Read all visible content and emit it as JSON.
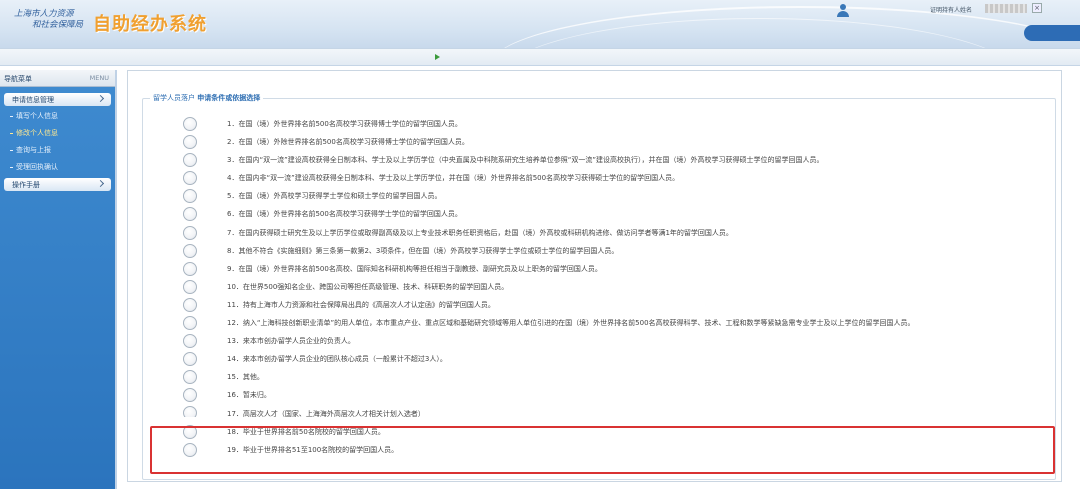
{
  "header": {
    "org_line1": "上海市人力资源",
    "org_line2": "和社会保障局",
    "app_title": "自助经办系统",
    "user_name": "证明持有人姓名",
    "close_label": "×"
  },
  "sidebar": {
    "title": "导航菜单",
    "title_en": "MENU",
    "groups": [
      {
        "label": "申请信息管理",
        "items": [
          {
            "label": "填写个人信息"
          },
          {
            "label": "修改个人信息"
          },
          {
            "label": "查询与上报"
          },
          {
            "label": "受理回执确认"
          }
        ]
      },
      {
        "label": "操作手册"
      }
    ]
  },
  "main": {
    "breadcrumb_section": "留学人员落户",
    "breadcrumb_page": "申请条件或依据选择",
    "options": [
      {
        "label": "1．在国（境）外世界排名前500名高校学习获得博士学位的留学回国人员。"
      },
      {
        "label": "2．在国（境）外除世界排名前500名高校学习获得博士学位的留学回国人员。"
      },
      {
        "label": "3．在国内“双一流”建设高校获得全日制本科、学士及以上学历学位（中央直属及中科院系研究生培养单位参照“双一流”建设高校执行），并在国（境）外高校学习获得硕士学位的留学回国人员。"
      },
      {
        "label": "4．在国内非“双一流”建设高校获得全日制本科、学士及以上学历学位，并在国（境）外世界排名前500名高校学习获得硕士学位的留学回国人员。"
      },
      {
        "label": "5．在国（境）外高校学习获得学士学位和硕士学位的留学回国人员。"
      },
      {
        "label": "6．在国（境）外世界排名前500名高校学习获得学士学位的留学回国人员。"
      },
      {
        "label": "7．在国内获得硕士研究生及以上学历学位或取得副高级及以上专业技术职务任职资格后，赴国（境）外高校或科研机构进修、做访问学者等满1年的留学回国人员。"
      },
      {
        "label": "8．其他不符合《实施细则》第三条第一款第2、3项条件，但在国（境）外高校学习获得学士学位或硕士学位的留学回国人员。"
      },
      {
        "label": "9．在国（境）外世界排名前500名高校、国际知名科研机构等担任相当于副教授、副研究员及以上职务的留学回国人员。"
      },
      {
        "label": "10．在世界500强知名企业、跨国公司等担任高级管理、技术、科研职务的留学回国人员。"
      },
      {
        "label": "11．持有上海市人力资源和社会保障局出具的《高层次人才认定函》的留学回国人员。"
      },
      {
        "label": "12．纳入“上海科技创新职业清单”的用人单位，本市重点产业、重点区域和基础研究领域等用人单位引进的在国（境）外世界排名前500名高校获得科学、技术、工程和数学等紧缺急需专业学士及以上学位的留学回国人员。"
      },
      {
        "label": "13．来本市创办留学人员企业的负责人。"
      },
      {
        "label": "14．来本市创办留学人员企业的团队核心成员（一般累计不超过3人）。"
      },
      {
        "label": "15．其他。"
      },
      {
        "label": "16．暂未归。"
      },
      {
        "label": "17．高层次人才（国家、上海海外高层次人才相关计划入选者）"
      },
      {
        "label": "18．毕业于世界排名前50名院校的留学回国人员。"
      },
      {
        "label": "19．毕业于世界排名51至100名院校的留学回国人员。"
      }
    ]
  },
  "colors": {
    "accent_blue": "#2f6fb3",
    "sidebar_blue": "#3f8bd0",
    "title_orange": "#f0a030",
    "highlight_red": "#d93232"
  }
}
